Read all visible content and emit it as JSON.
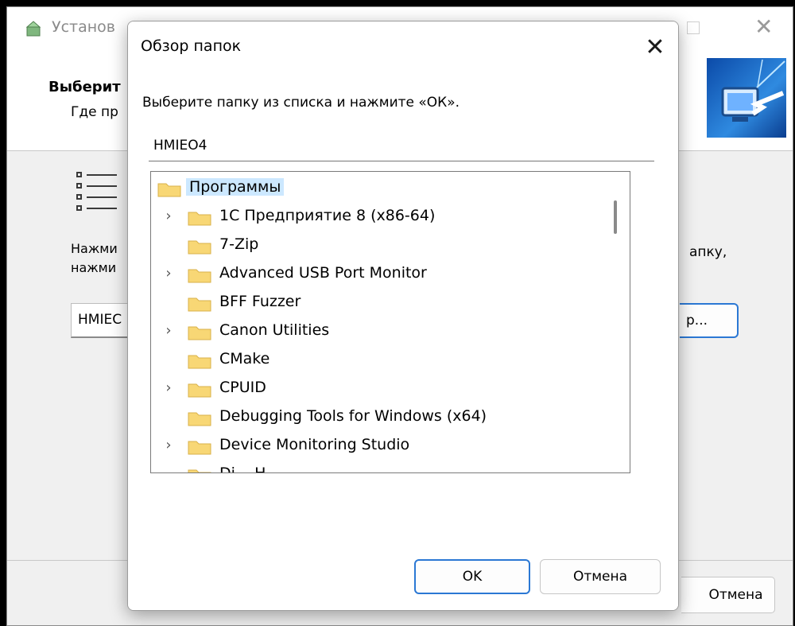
{
  "colors": {
    "accent": "#2b78d4",
    "folder": "#f8d775",
    "selection": "#cce8ff"
  },
  "installer": {
    "title": "Установ",
    "heading": "Выберит",
    "subheading": "Где пр",
    "body_text_line1": "Нажми",
    "body_text_line2": "нажми",
    "body_text_right": "апку,",
    "path_value": "HMIEC",
    "browse_label": "р...",
    "cancel_label": "Отмена",
    "icons": [
      "installer-app-icon",
      "maximize-icon",
      "close-icon",
      "computer-arrow-banner-icon",
      "list-icon"
    ]
  },
  "dialog": {
    "title": "Обзор папок",
    "close_symbol": "✕",
    "instruction": "Выберите папку из списка и нажмите «ОК».",
    "folder_name": "HMIEO4",
    "tree": {
      "root": {
        "label": "Программы",
        "selected": true
      },
      "items": [
        {
          "label": "1С Предприятие 8 (x86-64)",
          "expandable": true
        },
        {
          "label": "7-Zip",
          "expandable": false
        },
        {
          "label": "Advanced USB Port Monitor",
          "expandable": true
        },
        {
          "label": "BFF Fuzzer",
          "expandable": false
        },
        {
          "label": "Canon Utilities",
          "expandable": true
        },
        {
          "label": "CMake",
          "expandable": false
        },
        {
          "label": "CPUID",
          "expandable": true
        },
        {
          "label": "Debugging Tools for Windows (x64)",
          "expandable": false
        },
        {
          "label": "Device Monitoring Studio",
          "expandable": true
        },
        {
          "label": "Di... H...",
          "expandable": false
        }
      ],
      "chevron_symbol": "›"
    },
    "ok_label": "OK",
    "cancel_label": "Отмена"
  }
}
